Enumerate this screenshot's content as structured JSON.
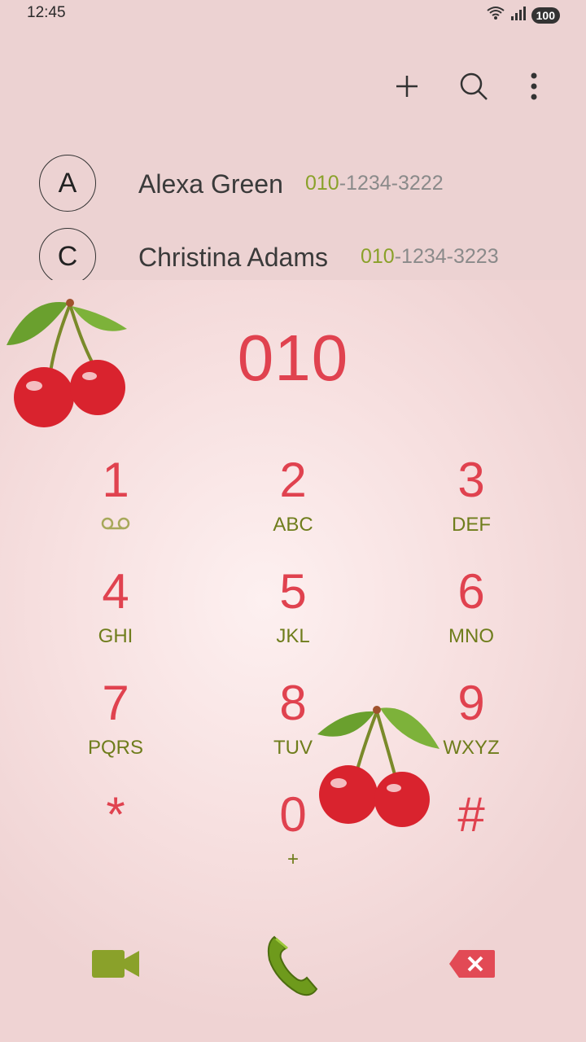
{
  "status": {
    "time": "12:45",
    "battery": "100"
  },
  "toolbar": {
    "add_icon": "plus-icon",
    "search_icon": "search-icon",
    "more_icon": "more-vert-icon"
  },
  "contacts": [
    {
      "initial": "A",
      "name": "Alexa Green",
      "number_match": "010",
      "number_rest": "-1234-3222"
    },
    {
      "initial": "C",
      "name": "Christina Adams",
      "number_match": "010",
      "number_rest": "-1234-3223"
    }
  ],
  "dialer": {
    "entered": "010",
    "keys": [
      {
        "digit": "1",
        "sub": ""
      },
      {
        "digit": "2",
        "sub": "ABC"
      },
      {
        "digit": "3",
        "sub": "DEF"
      },
      {
        "digit": "4",
        "sub": "GHI"
      },
      {
        "digit": "5",
        "sub": "JKL"
      },
      {
        "digit": "6",
        "sub": "MNO"
      },
      {
        "digit": "7",
        "sub": "PQRS"
      },
      {
        "digit": "8",
        "sub": "TUV"
      },
      {
        "digit": "9",
        "sub": "WXYZ"
      },
      {
        "digit": "*",
        "sub": ""
      },
      {
        "digit": "0",
        "sub": "+"
      },
      {
        "digit": "#",
        "sub": ""
      }
    ]
  },
  "colors": {
    "accent": "#e0424f",
    "sub": "#6f7d1c",
    "green": "#8aa12a",
    "background": "#ecd2d2"
  }
}
